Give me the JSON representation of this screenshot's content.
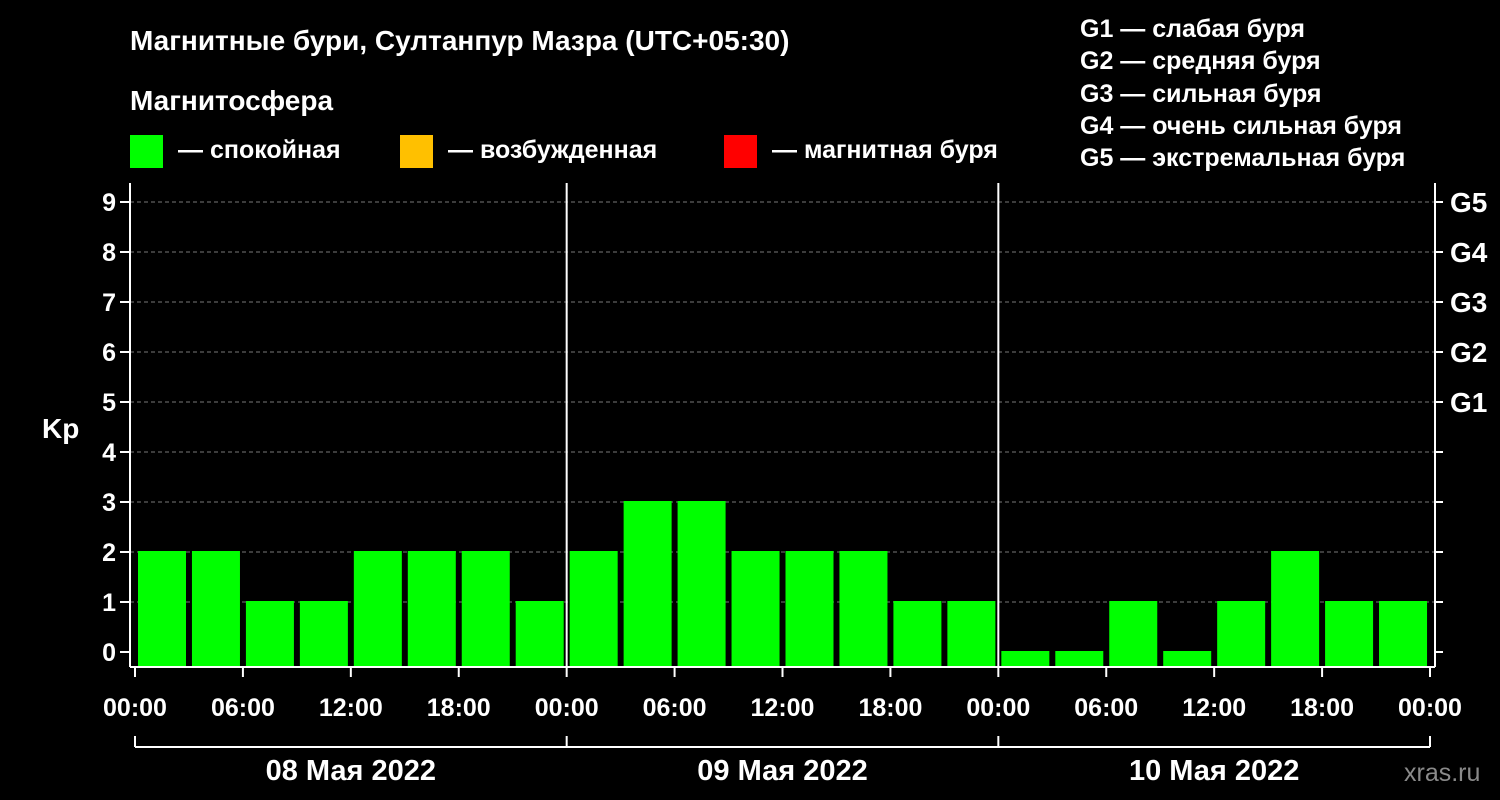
{
  "chart_data": {
    "type": "bar",
    "title": "Магнитные бури, Султанпур Мазра (UTC+05:30)",
    "ylabel": "Kp",
    "ylim": [
      0,
      9
    ],
    "yticks": [
      "0",
      "1",
      "2",
      "3",
      "4",
      "5",
      "6",
      "7",
      "8",
      "9"
    ],
    "right_axis": [
      {
        "value": 5,
        "label": "G1"
      },
      {
        "value": 6,
        "label": "G2"
      },
      {
        "value": 7,
        "label": "G3"
      },
      {
        "value": 8,
        "label": "G4"
      },
      {
        "value": 9,
        "label": "G5"
      }
    ],
    "x_time_labels": [
      "00:00",
      "06:00",
      "12:00",
      "18:00",
      "00:00",
      "06:00",
      "12:00",
      "18:00",
      "00:00",
      "06:00",
      "12:00",
      "18:00",
      "00:00"
    ],
    "x_date_labels": [
      "08 Мая 2022",
      "09 Мая 2022",
      "10 Мая 2022"
    ],
    "bar_hours": [
      3,
      6,
      9,
      12,
      15,
      18,
      21,
      24,
      27,
      30,
      33,
      36,
      39,
      42,
      45,
      48,
      51,
      54,
      57,
      60,
      63,
      66,
      69,
      72
    ],
    "values": [
      2,
      2,
      1,
      1,
      2,
      2,
      2,
      1,
      2,
      3,
      3,
      2,
      2,
      2,
      1,
      1,
      0,
      0,
      1,
      0,
      1,
      2,
      1,
      1
    ],
    "legend": {
      "heading": "Магнитосфера",
      "items": [
        {
          "label": "— спокойная",
          "color": "#00ff00"
        },
        {
          "label": "— возбужденная",
          "color": "#ffc000"
        },
        {
          "label": "— магнитная буря",
          "color": "#ff0000"
        }
      ]
    },
    "storm_levels": [
      "G1 — слабая буря",
      "G2 — средняя буря",
      "G3 — сильная буря",
      "G4 — очень сильная буря",
      "G5 — экстремальная буря"
    ],
    "grid": true,
    "watermark": "xras.ru"
  }
}
